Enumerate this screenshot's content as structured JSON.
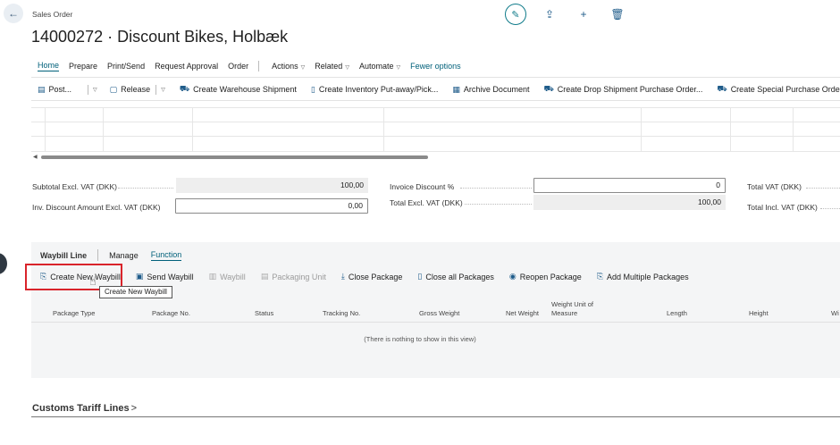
{
  "header": {
    "breadcrumb": "Sales Order",
    "title": "14000272 · Discount Bikes, Holbæk"
  },
  "menu": {
    "items": [
      {
        "label": "Home",
        "active": true
      },
      {
        "label": "Prepare"
      },
      {
        "label": "Print/Send"
      },
      {
        "label": "Request Approval"
      },
      {
        "label": "Order"
      }
    ],
    "dropdowns": [
      "Actions",
      "Related",
      "Automate"
    ],
    "fewer_options": "Fewer options"
  },
  "actions": {
    "post": "Post...",
    "release": "Release",
    "create_warehouse_shipment": "Create Warehouse Shipment",
    "create_inventory_putaway": "Create Inventory Put-away/Pick...",
    "archive_document": "Archive Document",
    "create_drop_shipment": "Create Drop Shipment Purchase Order...",
    "create_special_purchase": "Create Special Purchase Order..."
  },
  "totals": {
    "subtotal_label": "Subtotal Excl. VAT (DKK)",
    "subtotal_value": "100,00",
    "inv_discount_amount_label": "Inv. Discount Amount Excl. VAT (DKK)",
    "inv_discount_amount_value": "0,00",
    "invoice_discount_pct_label": "Invoice Discount %",
    "invoice_discount_pct_value": "0",
    "total_excl_vat_label": "Total Excl. VAT (DKK)",
    "total_excl_vat_value": "100,00",
    "total_vat_label": "Total VAT (DKK)",
    "total_incl_vat_label": "Total Incl. VAT (DKK)"
  },
  "waybill": {
    "title": "Waybill Line",
    "tabs": [
      {
        "label": "Manage"
      },
      {
        "label": "Function",
        "active": true
      }
    ],
    "actions": {
      "create_new_waybill": "Create New Waybill",
      "send_waybill": "Send Waybill",
      "waybill": "Waybill",
      "packaging_unit": "Packaging Unit",
      "close_package": "Close Package",
      "close_all_packages": "Close all Packages",
      "reopen_package": "Reopen Package",
      "add_multiple_packages": "Add Multiple Packages"
    },
    "tooltip": "Create New Waybill",
    "columns": {
      "package_type": "Package Type",
      "package_no": "Package No.",
      "status": "Status",
      "tracking_no": "Tracking No.",
      "gross_weight": "Gross Weight",
      "net_weight": "Net Weight",
      "weight_unit_1": "Weight Unit of",
      "weight_unit_2": "Measure",
      "length": "Length",
      "height": "Height",
      "width_partial": "Wi"
    },
    "empty_message": "(There is nothing to show in this view)"
  },
  "customs": {
    "title": "Customs Tariff Lines"
  },
  "colors": {
    "accent": "#00607a",
    "highlight": "#d9242b",
    "icon": "#1f5c8a"
  }
}
